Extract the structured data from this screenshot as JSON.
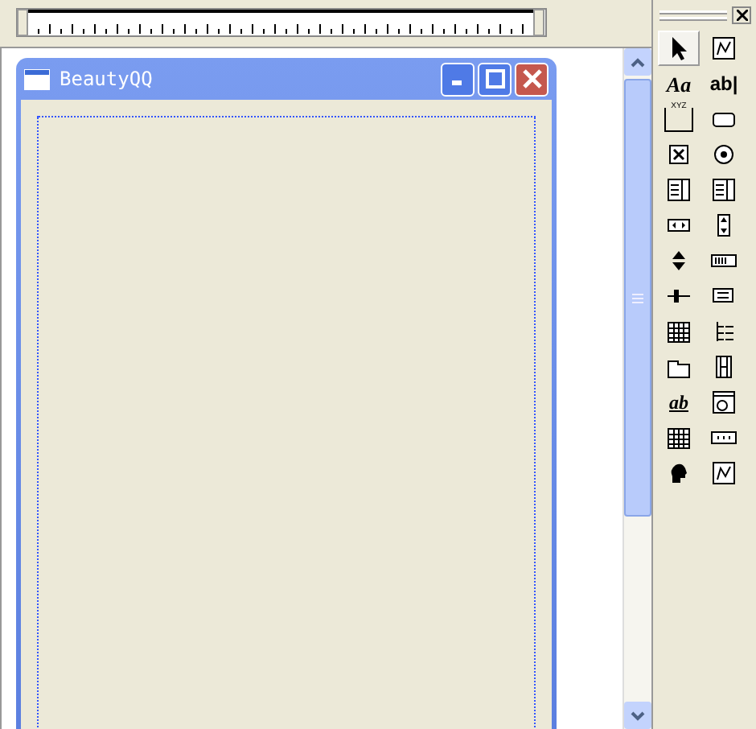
{
  "form_window": {
    "title": "BeautyQQ"
  },
  "toolbox": {
    "tools": [
      {
        "kind": "pointer",
        "selected": true
      },
      {
        "kind": "picture",
        "selected": false
      },
      {
        "kind": "label",
        "glyph": "Aa",
        "selected": false
      },
      {
        "kind": "textbox",
        "glyph": "ab|",
        "selected": false
      },
      {
        "kind": "frame",
        "glyph": "XYZ",
        "selected": false
      },
      {
        "kind": "button",
        "selected": false
      },
      {
        "kind": "xbox",
        "selected": false
      },
      {
        "kind": "dotcircle",
        "selected": false
      },
      {
        "kind": "combo",
        "selected": false
      },
      {
        "kind": "list",
        "selected": false
      },
      {
        "kind": "hscroll",
        "selected": false
      },
      {
        "kind": "vscroll",
        "selected": false
      },
      {
        "kind": "updown",
        "selected": false
      },
      {
        "kind": "progress",
        "selected": false
      },
      {
        "kind": "slider",
        "selected": false
      },
      {
        "kind": "listview",
        "selected": false
      },
      {
        "kind": "calendar",
        "selected": false
      },
      {
        "kind": "tree",
        "selected": false
      },
      {
        "kind": "tabstrip",
        "selected": false
      },
      {
        "kind": "film",
        "selected": false
      },
      {
        "kind": "richtext",
        "glyph": "ab",
        "selected": false
      },
      {
        "kind": "browser",
        "selected": false
      },
      {
        "kind": "grid",
        "selected": false
      },
      {
        "kind": "dots",
        "selected": false
      },
      {
        "kind": "head",
        "selected": false
      },
      {
        "kind": "image",
        "selected": false
      }
    ]
  }
}
